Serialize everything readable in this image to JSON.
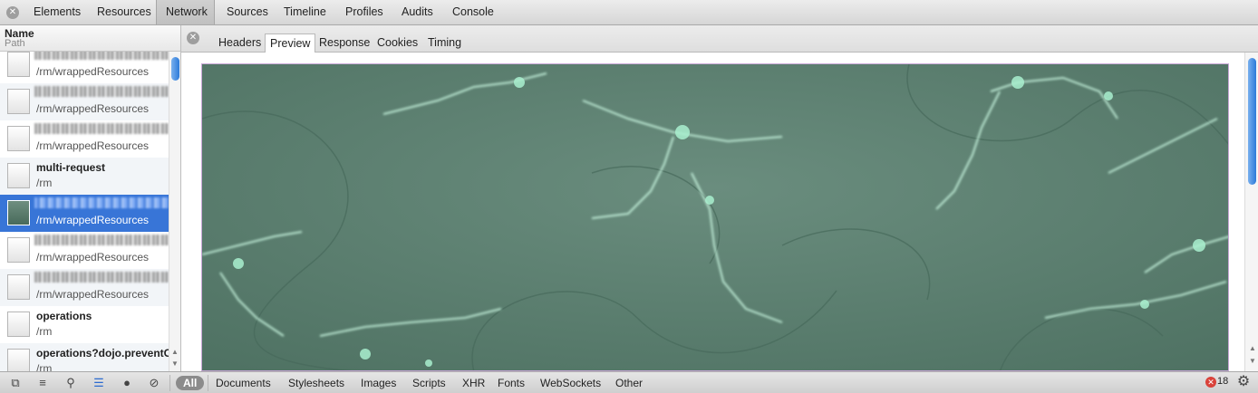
{
  "top_tabs": [
    "Elements",
    "Resources",
    "Network",
    "Sources",
    "Timeline",
    "Profiles",
    "Audits",
    "Console"
  ],
  "active_top_tab": "Network",
  "columns": {
    "name": "Name",
    "path": "Path"
  },
  "requests": [
    {
      "name": "",
      "path": "/rm/wrappedResources"
    },
    {
      "name": "",
      "path": "/rm/wrappedResources"
    },
    {
      "name": "",
      "path": "/rm/wrappedResources"
    },
    {
      "name": "multi-request",
      "path": "/rm"
    },
    {
      "name": "",
      "path": "/rm/wrappedResources",
      "selected": true
    },
    {
      "name": "",
      "path": "/rm/wrappedResources"
    },
    {
      "name": "",
      "path": "/rm/wrappedResources"
    },
    {
      "name": "operations",
      "path": "/rm"
    },
    {
      "name": "operations?dojo.preventC",
      "path": "/rm"
    }
  ],
  "detail_tabs": [
    "Headers",
    "Preview",
    "Response",
    "Cookies",
    "Timing"
  ],
  "active_detail_tab": "Preview",
  "filters": [
    "All",
    "Documents",
    "Stylesheets",
    "Images",
    "Scripts",
    "XHR",
    "Fonts",
    "WebSockets",
    "Other"
  ],
  "active_filter": "All",
  "error_count": "18",
  "icons": {
    "close": "close-icon",
    "dock": "dock-icon",
    "console": "console-icon",
    "search": "search-icon",
    "list": "list-view-icon",
    "record": "record-icon",
    "clear": "clear-icon",
    "settings": "gear-icon",
    "error": "error-icon"
  },
  "colors": {
    "selection": "#3875d7",
    "preview_background": "#5b7e6e",
    "preview_highlight": "#a9f0cf"
  }
}
